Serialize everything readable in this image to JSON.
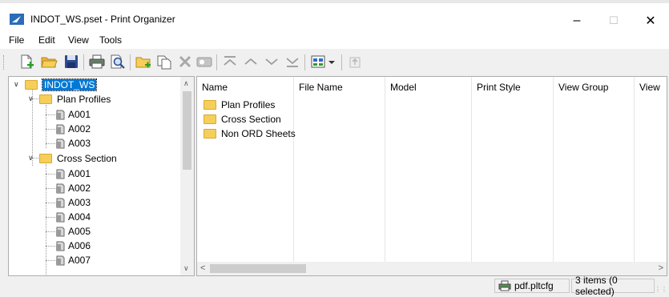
{
  "window": {
    "title": "INDOT_WS.pset - Print Organizer",
    "minimize": "–",
    "maximize": "☐",
    "close": "✕"
  },
  "menu": [
    "File",
    "Edit",
    "View",
    "Tools"
  ],
  "toolbar": [
    "new-icon",
    "open-icon",
    "save-icon",
    "print-icon",
    "print-preview-icon",
    "new-folder-icon",
    "add-files-icon",
    "delete-icon",
    "properties-icon",
    "move-to-top-icon",
    "move-up-icon",
    "move-down-icon",
    "move-to-bottom-icon",
    "display-icon",
    "dropdown-icon",
    "go-to-parent-icon"
  ],
  "tree": {
    "root": "INDOT_WS",
    "folders": [
      {
        "label": "Plan Profiles",
        "items": [
          "A001",
          "A002",
          "A003"
        ]
      },
      {
        "label": "Cross Section",
        "items": [
          "A001",
          "A002",
          "A003",
          "A004",
          "A005",
          "A006",
          "A007"
        ]
      }
    ]
  },
  "list": {
    "columns": [
      "Name",
      "File Name",
      "Model",
      "Print Style",
      "View Group",
      "View"
    ],
    "rows": [
      "Plan Profiles",
      "Cross Section",
      "Non ORD Sheets"
    ]
  },
  "status": {
    "printer": "pdf.pltcfg",
    "count": "3 items (0 selected)"
  },
  "colors": {
    "selection": "#0078d7",
    "folder": "#f6cf5a"
  }
}
